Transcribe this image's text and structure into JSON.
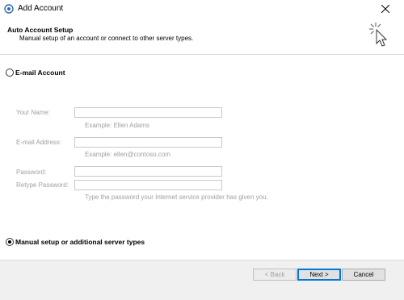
{
  "window": {
    "title": "Add Account",
    "close_icon": "close-icon",
    "app_icon": "outlook-icon"
  },
  "header": {
    "title": "Auto Account Setup",
    "subtitle": "Manual setup of an account or connect to other server types.",
    "icon": "wizard-cursor-icon"
  },
  "options": {
    "email_account": {
      "label": "E-mail Account",
      "selected": false
    },
    "manual_setup": {
      "label": "Manual setup or additional server types",
      "selected": true
    }
  },
  "form": {
    "your_name": {
      "label": "Your Name:",
      "value": "",
      "hint": "Example: Ellen Adams"
    },
    "email_address": {
      "label": "E-mail Address:",
      "value": "",
      "hint": "Example: ellen@contoso.com"
    },
    "password": {
      "label": "Password:",
      "value": ""
    },
    "retype_password": {
      "label": "Retype Password:",
      "value": "",
      "hint": "Type the password your Internet service provider has given you."
    }
  },
  "footer": {
    "back_label": "< Back",
    "next_label": "Next >",
    "cancel_label": "Cancel"
  },
  "colors": {
    "accent": "#0078d7",
    "disabled_text": "#a0a0a0"
  }
}
